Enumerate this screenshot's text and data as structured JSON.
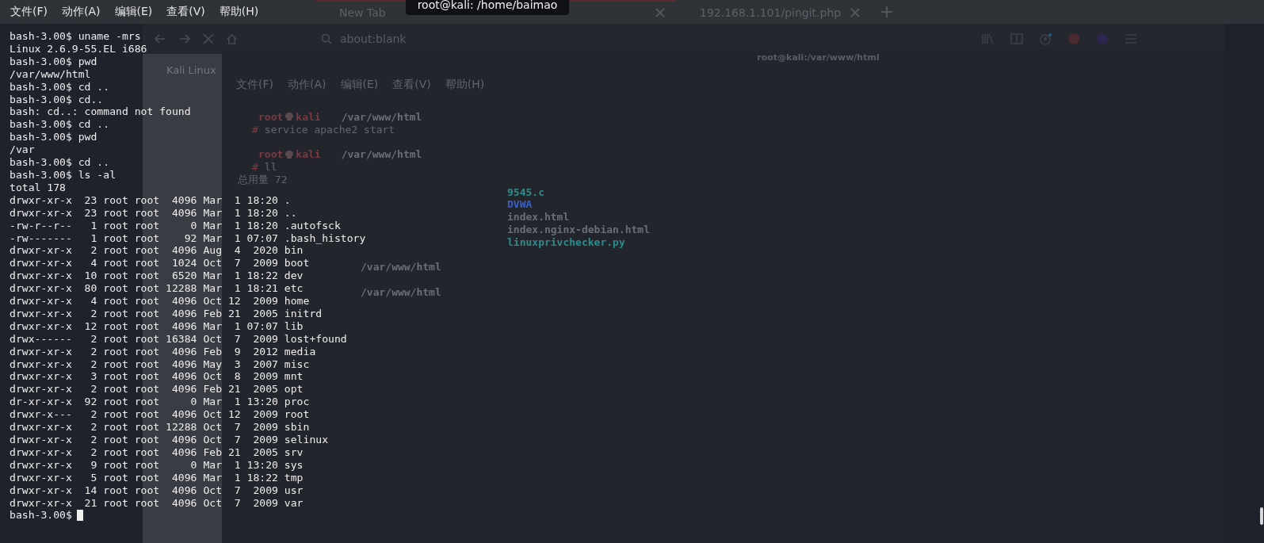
{
  "menu": [
    "文件(F)",
    "动作(A)",
    "编辑(E)",
    "查看(V)",
    "帮助(H)"
  ],
  "tooltip": "root@kali: /home/baimao",
  "browser": {
    "tabs": [
      {
        "label": "New Tab",
        "selected": true
      },
      {
        "label": "192.168.1.101/pingit.php",
        "selected": false
      }
    ],
    "address": "about:blank",
    "bookmark": "Kali Linux"
  },
  "background_terminal": {
    "title": "root@kali:/var/www/html",
    "menu": [
      "文件(F)",
      "动作(A)",
      "编辑(E)",
      "查看(V)",
      "帮助(H)"
    ],
    "lines": [
      {
        "kind": "prompt",
        "user": "root",
        "host": "kali",
        "path": "/var/www/html"
      },
      {
        "kind": "command",
        "mark": "#",
        "text": "service apache2 start"
      },
      {
        "kind": "blank"
      },
      {
        "kind": "prompt",
        "user": "root",
        "host": "kali",
        "path": "/var/www/html"
      },
      {
        "kind": "command",
        "mark": "#",
        "text": "ll"
      },
      {
        "kind": "text",
        "text": "总用量 72"
      },
      {
        "kind": "file",
        "text": "9545.c",
        "color": "#2e8b8b"
      },
      {
        "kind": "file",
        "text": "DVWA",
        "color": "#3b5fc0"
      },
      {
        "kind": "file",
        "text": "index.html",
        "color": "#6a6e76"
      },
      {
        "kind": "file",
        "text": "index.nginx-debian.html",
        "color": "#6a6e76"
      },
      {
        "kind": "file",
        "text": "linuxprivchecker.py",
        "color": "#2e8b8b"
      },
      {
        "kind": "blank"
      },
      {
        "kind": "path",
        "path": "/var/www/html"
      },
      {
        "kind": "blank"
      },
      {
        "kind": "path",
        "path": "/var/www/html"
      }
    ]
  },
  "terminal": {
    "lines": [
      "bash-3.00$ uname -mrs",
      "Linux 2.6.9-55.EL i686",
      "bash-3.00$ pwd",
      "/var/www/html",
      "bash-3.00$ cd ..",
      "bash-3.00$ cd..",
      "bash: cd..: command not found",
      "bash-3.00$ cd ..",
      "bash-3.00$ pwd",
      "/var",
      "bash-3.00$ cd ..",
      "bash-3.00$ ls -al",
      "total 178",
      "drwxr-xr-x  23 root root  4096 Mar  1 18:20 .",
      "drwxr-xr-x  23 root root  4096 Mar  1 18:20 ..",
      "-rw-r--r--   1 root root     0 Mar  1 18:20 .autofsck",
      "-rw-------   1 root root    92 Mar  1 07:07 .bash_history",
      "drwxr-xr-x   2 root root  4096 Aug  4  2020 bin",
      "drwxr-xr-x   4 root root  1024 Oct  7  2009 boot",
      "drwxr-xr-x  10 root root  6520 Mar  1 18:22 dev",
      "drwxr-xr-x  80 root root 12288 Mar  1 18:21 etc",
      "drwxr-xr-x   4 root root  4096 Oct 12  2009 home",
      "drwxr-xr-x   2 root root  4096 Feb 21  2005 initrd",
      "drwxr-xr-x  12 root root  4096 Mar  1 07:07 lib",
      "drwx------   2 root root 16384 Oct  7  2009 lost+found",
      "drwxr-xr-x   2 root root  4096 Feb  9  2012 media",
      "drwxr-xr-x   2 root root  4096 May  3  2007 misc",
      "drwxr-xr-x   3 root root  4096 Oct  8  2009 mnt",
      "drwxr-xr-x   2 root root  4096 Feb 21  2005 opt",
      "dr-xr-xr-x  92 root root     0 Mar  1 13:20 proc",
      "drwxr-x---   2 root root  4096 Oct 12  2009 root",
      "drwxr-xr-x   2 root root 12288 Oct  7  2009 sbin",
      "drwxr-xr-x   2 root root  4096 Oct  7  2009 selinux",
      "drwxr-xr-x   2 root root  4096 Feb 21  2005 srv",
      "drwxr-xr-x   9 root root     0 Mar  1 13:20 sys",
      "drwxr-xr-x   5 root root  4096 Mar  1 18:22 tmp",
      "drwxr-xr-x  14 root root  4096 Oct  7  2009 usr",
      "drwxr-xr-x  21 root root  4096 Oct  7  2009 var"
    ],
    "prompt": "bash-3.00$"
  }
}
